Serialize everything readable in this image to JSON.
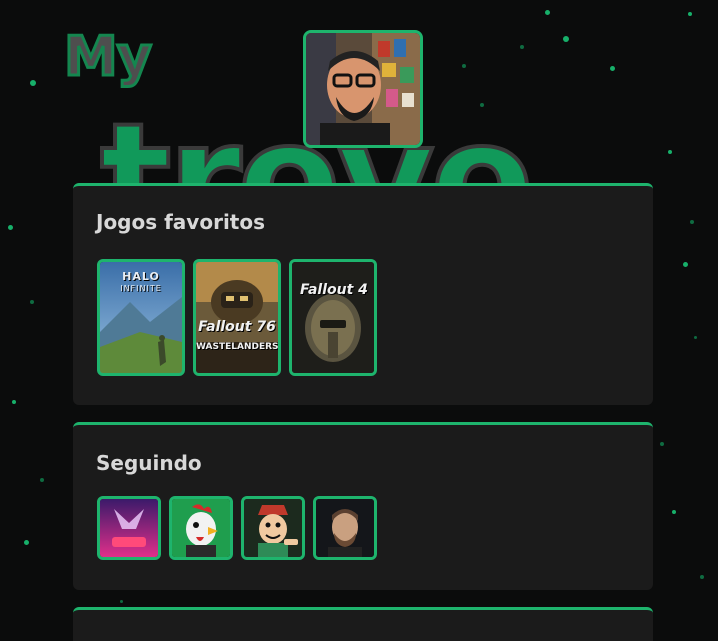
{
  "brand": {
    "prefix": "My",
    "name": "trovo"
  },
  "profile": {
    "avatar_icon": "profile-photo-icon"
  },
  "favorites": {
    "title": "Jogos favoritos",
    "games": [
      {
        "title": "HALO",
        "subtitle": "INFINITE"
      },
      {
        "title": "Fallout 76",
        "subtitle": "WASTELANDERS"
      },
      {
        "title": "Fallout 4"
      }
    ]
  },
  "following": {
    "title": "Seguindo",
    "channels": [
      {
        "icon": "purple-channel-avatar-icon"
      },
      {
        "icon": "rooster-channel-avatar-icon"
      },
      {
        "icon": "cartoon-channel-avatar-icon"
      },
      {
        "icon": "man-channel-avatar-icon"
      }
    ]
  },
  "colors": {
    "accent": "#1eb46d",
    "background": "#0b0c0c",
    "card": "#1b1b1b"
  }
}
